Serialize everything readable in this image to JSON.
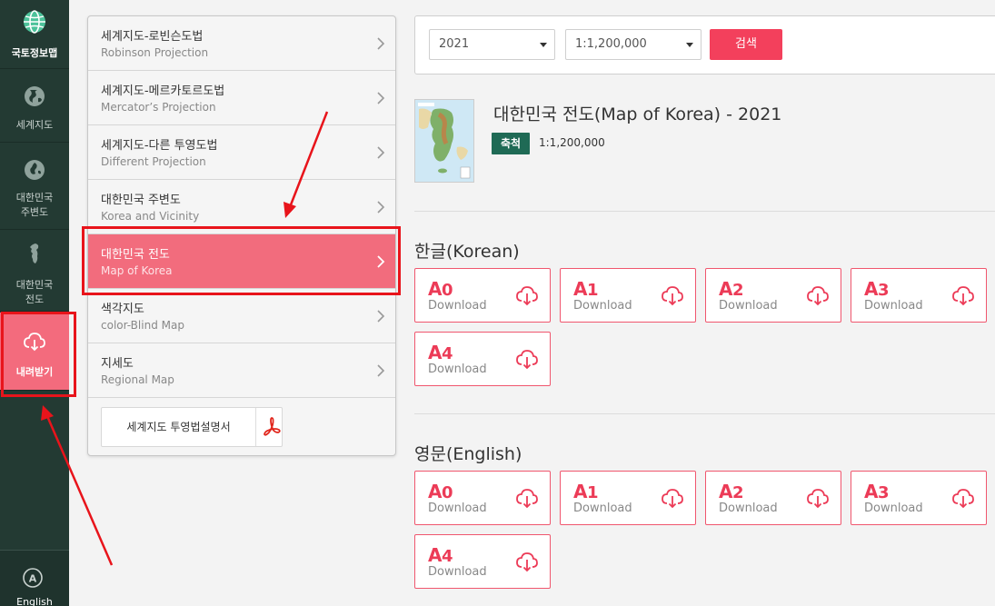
{
  "sidebar": {
    "logo_label": "국토정보맵",
    "items": [
      {
        "label_line1": "세계지도",
        "label_line2": ""
      },
      {
        "label_line1": "대한민국",
        "label_line2": "주변도"
      },
      {
        "label_line1": "대한민국",
        "label_line2": "전도"
      },
      {
        "label_line1": "내려받기",
        "label_line2": ""
      }
    ],
    "english_label": "English"
  },
  "menu": {
    "items": [
      {
        "ko": "세계지도-로빈슨도법",
        "en": "Robinson Projection"
      },
      {
        "ko": "세계지도-메르카토르도법",
        "en": "Mercator’s Projection"
      },
      {
        "ko": "세계지도-다른 투영도법",
        "en": "Different Projection"
      },
      {
        "ko": "대한민국 주변도",
        "en": "Korea and Vicinity"
      },
      {
        "ko": "대한민국 전도",
        "en": "Map of Korea"
      },
      {
        "ko": "색각지도",
        "en": "color-Blind Map"
      },
      {
        "ko": "지세도",
        "en": "Regional Map"
      }
    ],
    "pdf_button_label": "세계지도 투영법설명서"
  },
  "search": {
    "year": "2021",
    "scale": "1:1,200,000",
    "button_label": "검색"
  },
  "result": {
    "title": "대한민국 전도(Map of Korea) - 2021",
    "scale_badge": "축척",
    "scale_value": "1:1,200,000"
  },
  "sections": [
    {
      "title": "한글(Korean)",
      "downloads": [
        {
          "letter": "A",
          "num": "0",
          "label": "Download"
        },
        {
          "letter": "A",
          "num": "1",
          "label": "Download"
        },
        {
          "letter": "A",
          "num": "2",
          "label": "Download"
        },
        {
          "letter": "A",
          "num": "3",
          "label": "Download"
        },
        {
          "letter": "A",
          "num": "4",
          "label": "Download"
        }
      ]
    },
    {
      "title": "영문(English)",
      "downloads": [
        {
          "letter": "A",
          "num": "0",
          "label": "Download"
        },
        {
          "letter": "A",
          "num": "1",
          "label": "Download"
        },
        {
          "letter": "A",
          "num": "2",
          "label": "Download"
        },
        {
          "letter": "A",
          "num": "3",
          "label": "Download"
        },
        {
          "letter": "A",
          "num": "4",
          "label": "Download"
        }
      ]
    }
  ],
  "colors": {
    "sidebar_bg": "#233a33",
    "accent_pink": "#f26c7d",
    "accent_red": "#ec3b57",
    "badge_green": "#1f6a55",
    "annotation_red": "#e8141b"
  }
}
